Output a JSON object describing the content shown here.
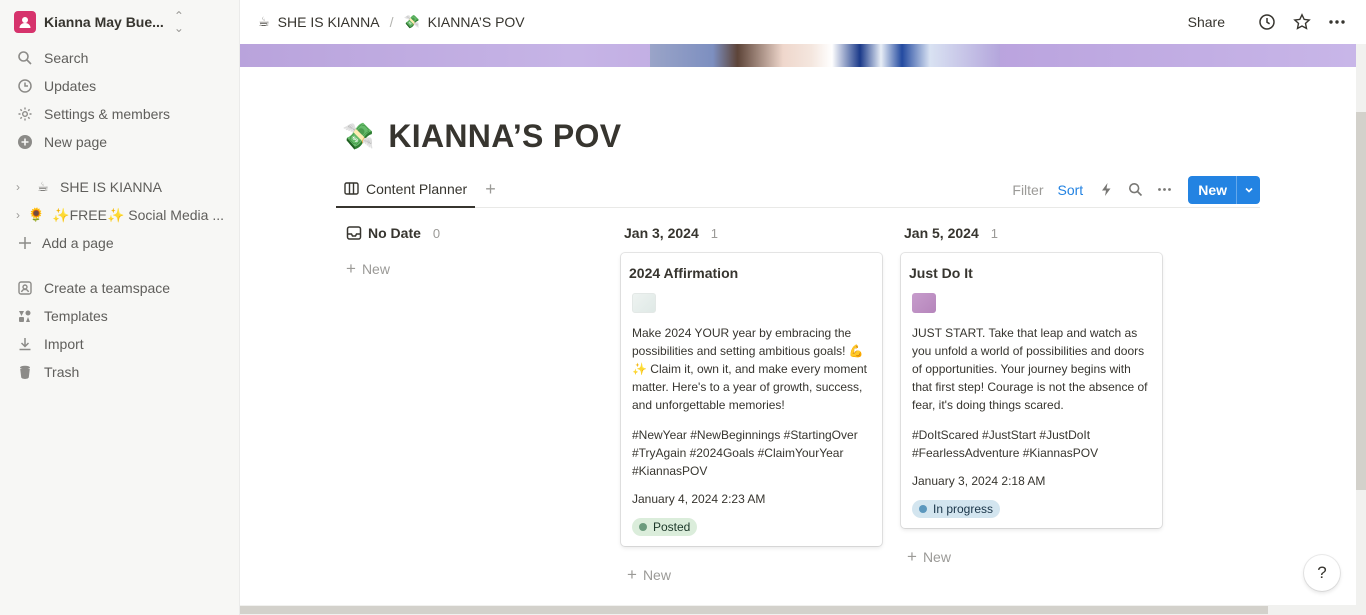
{
  "workspace": {
    "name": "Kianna May Bue...",
    "avatar_color": "#d6336c"
  },
  "sidebar": {
    "nav": [
      {
        "label": "Search",
        "icon": "search-icon"
      },
      {
        "label": "Updates",
        "icon": "clock-icon"
      },
      {
        "label": "Settings & members",
        "icon": "gear-icon"
      },
      {
        "label": "New page",
        "icon": "plus-circle-icon"
      }
    ],
    "pages": [
      {
        "emoji": "☕",
        "label": "SHE IS KIANNA"
      },
      {
        "emoji": "🌻",
        "label": "✨FREE✨ Social Media ..."
      }
    ],
    "add_page": "Add a page",
    "bottom": [
      {
        "label": "Create a teamspace",
        "icon": "teamspace-icon"
      },
      {
        "label": "Templates",
        "icon": "templates-icon"
      },
      {
        "label": "Import",
        "icon": "import-icon"
      },
      {
        "label": "Trash",
        "icon": "trash-icon"
      }
    ]
  },
  "topbar": {
    "breadcrumbs": [
      {
        "emoji": "☕",
        "label": "SHE IS KIANNA"
      },
      {
        "emoji": "💸",
        "label": "KIANNA’S POV"
      }
    ],
    "separator": "/",
    "share": "Share"
  },
  "page": {
    "emoji": "💸",
    "title": "KIANNA’S POV"
  },
  "view": {
    "tab": "Content Planner",
    "add": "+",
    "filter": "Filter",
    "sort": "Sort",
    "new_label": "New",
    "accent": "#2383e2"
  },
  "board": {
    "columns": [
      {
        "name": "No Date",
        "count": "0",
        "new_label": "New"
      },
      {
        "name": "Jan 3, 2024",
        "count": "1",
        "new_label": "New"
      },
      {
        "name": "Jan 5, 2024",
        "count": "1",
        "new_label": "New"
      }
    ],
    "cards": [
      {
        "title": "2024 Affirmation",
        "body": "Make 2024 YOUR year by embracing the possibilities and setting ambitious goals! 💪✨ Claim it, own it, and make every moment matter. Here's to a year of growth, success, and unforgettable memories!",
        "tags": "#NewYear #NewBeginnings #StartingOver #TryAgain #2024Goals #ClaimYourYear #KiannasPOV",
        "date": "January 4, 2024 2:23 AM",
        "status": "Posted",
        "status_bg": "#dbeddb",
        "status_dot": "#6c9b7d",
        "status_text": "#1c3829"
      },
      {
        "title": "Just Do It",
        "body": "JUST START. Take that leap and watch as you unfold a world of possibilities and doors of opportunities. Your journey begins with that first step! Courage is not the absence of fear, it's doing things scared.",
        "tags": "#DoItScared #JustStart #JustDoIt #FearlessAdventure #KiannasPOV",
        "date": "January 3, 2024 2:18 AM",
        "status": "In progress",
        "status_bg": "#d3e5ef",
        "status_dot": "#5b97bd",
        "status_text": "#183347"
      }
    ]
  },
  "help": "?"
}
